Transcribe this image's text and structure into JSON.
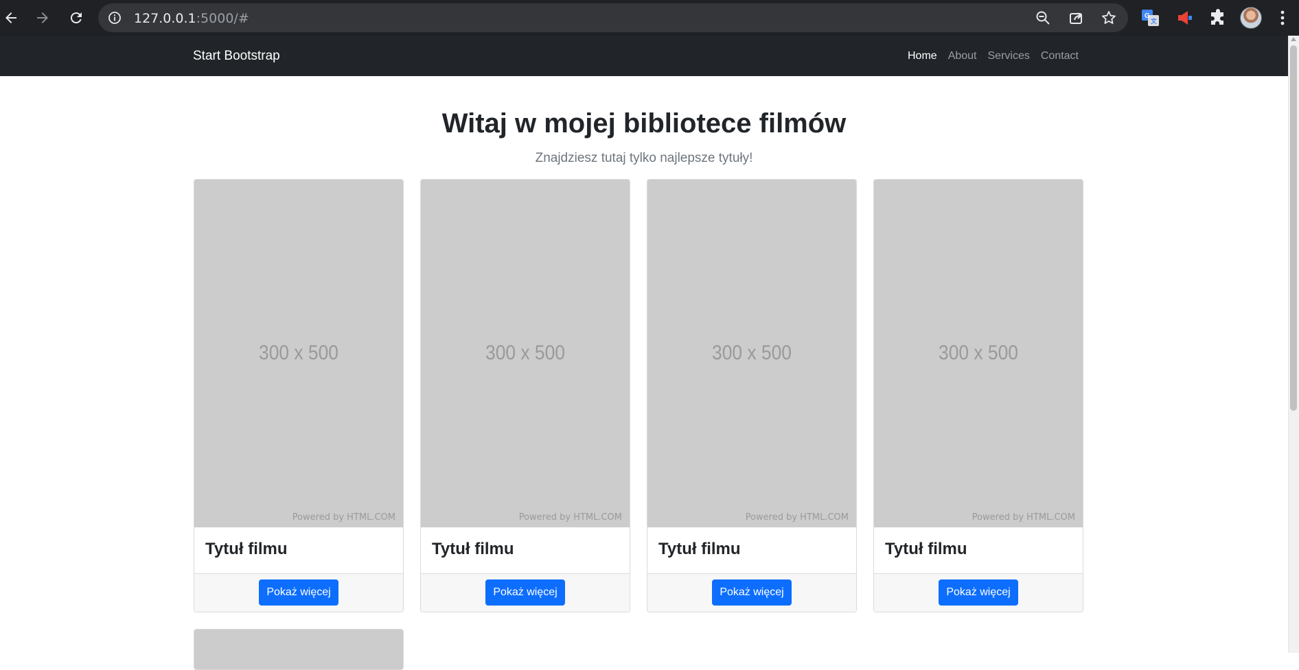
{
  "browser": {
    "url_host": "127.0.0.1",
    "url_path": ":5000/#"
  },
  "navbar": {
    "brand": "Start Bootstrap",
    "links": [
      {
        "label": "Home",
        "active": true
      },
      {
        "label": "About",
        "active": false
      },
      {
        "label": "Services",
        "active": false
      },
      {
        "label": "Contact",
        "active": false
      }
    ]
  },
  "header": {
    "title": "Witaj w mojej bibliotece filmów",
    "subtitle": "Znajdziesz tutaj tylko najlepsze tytuły!"
  },
  "cards": [
    {
      "placeholder": "300 x 500",
      "credit": "Powered by HTML.COM",
      "title": "Tytuł filmu",
      "button": "Pokaż więcej"
    },
    {
      "placeholder": "300 x 500",
      "credit": "Powered by HTML.COM",
      "title": "Tytuł filmu",
      "button": "Pokaż więcej"
    },
    {
      "placeholder": "300 x 500",
      "credit": "Powered by HTML.COM",
      "title": "Tytuł filmu",
      "button": "Pokaż więcej"
    },
    {
      "placeholder": "300 x 500",
      "credit": "Powered by HTML.COM",
      "title": "Tytuł filmu",
      "button": "Pokaż więcej"
    }
  ],
  "colors": {
    "navbar_bg": "#212529",
    "button_bg": "#0d6efd",
    "placeholder_bg": "#cccccc"
  },
  "icons": [
    "back-arrow-icon",
    "forward-arrow-icon",
    "reload-icon",
    "site-info-icon",
    "zoom-out-icon",
    "share-icon",
    "bookmark-star-icon",
    "google-translate-icon",
    "announcement-extension-icon",
    "extensions-puzzle-icon",
    "profile-avatar",
    "chrome-menu-icon"
  ]
}
